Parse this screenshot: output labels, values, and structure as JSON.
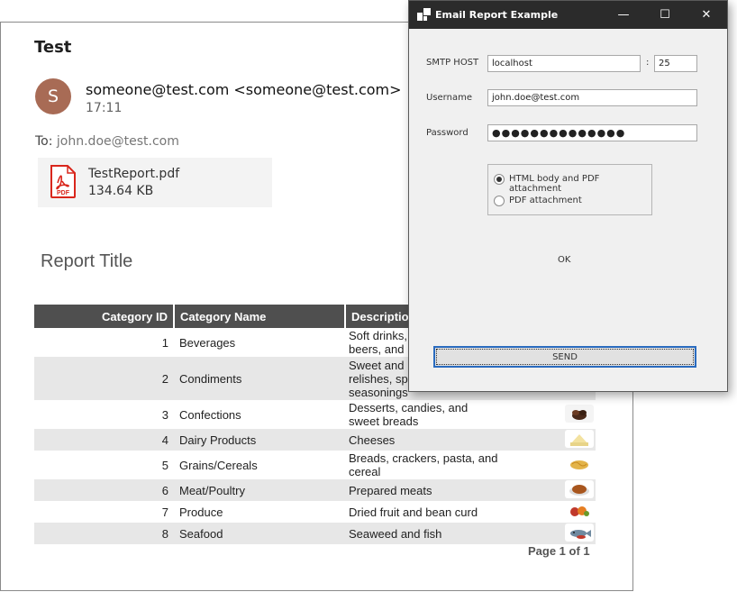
{
  "email": {
    "subject": "Test",
    "avatar_letter": "S",
    "sender": "someone@test.com <someone@test.com>",
    "time": "17:11",
    "to_label": "To: ",
    "to_address": "john.doe@test.com",
    "attachment": {
      "name": "TestReport.pdf",
      "size": "134.64 KB",
      "icon_label": "PDF"
    }
  },
  "report": {
    "title": "Report Title",
    "columns": [
      "Category ID",
      "Category Name",
      "Descriptio"
    ],
    "rows": [
      {
        "id": "1",
        "name": "Beverages",
        "desc1": "Soft drinks,",
        "desc2": "beers, and",
        "desc3": ""
      },
      {
        "id": "2",
        "name": "Condiments",
        "desc1": "Sweet and",
        "desc2": "relishes, sp",
        "desc3": "seasonings"
      },
      {
        "id": "3",
        "name": "Confections",
        "desc1": "Desserts, candies, and",
        "desc2": "sweet breads",
        "desc3": ""
      },
      {
        "id": "4",
        "name": "Dairy Products",
        "desc1": "Cheeses",
        "desc2": "",
        "desc3": ""
      },
      {
        "id": "5",
        "name": "Grains/Cereals",
        "desc1": "Breads, crackers, pasta, and",
        "desc2": "cereal",
        "desc3": ""
      },
      {
        "id": "6",
        "name": "Meat/Poultry",
        "desc1": "Prepared meats",
        "desc2": "",
        "desc3": ""
      },
      {
        "id": "7",
        "name": "Produce",
        "desc1": "Dried fruit and bean curd",
        "desc2": "",
        "desc3": ""
      },
      {
        "id": "8",
        "name": "Seafood",
        "desc1": "Seaweed and fish",
        "desc2": "",
        "desc3": ""
      }
    ],
    "footer": "Page 1 of 1"
  },
  "dialog": {
    "title": "Email Report Example",
    "smtp_label": "SMTP HOST",
    "smtp_host": "localhost",
    "smtp_port": "25",
    "port_separator": ":",
    "username_label": "Username",
    "username": "john.doe@test.com",
    "password_label": "Password",
    "password_masked": "●●●●●●●●●●●●●●",
    "radio_html": "HTML body and PDF attachment",
    "radio_pdf": "PDF attachment",
    "selected_option": "HTML body and PDF attachment",
    "ok": "OK",
    "send": "SEND",
    "controls": {
      "minimize": "—",
      "maximize": "☐",
      "close": "✕"
    }
  },
  "colors": {
    "titlebar": "#2b2b2b",
    "avatar": "#a86b55",
    "table_header": "#4f4f4f",
    "row_alt": "#e7e7e7",
    "send_border": "#2a6bbf",
    "pdf_red": "#d9261c"
  },
  "icons": {
    "attachment": "pdf-file-icon",
    "app": "app-window-icon"
  }
}
